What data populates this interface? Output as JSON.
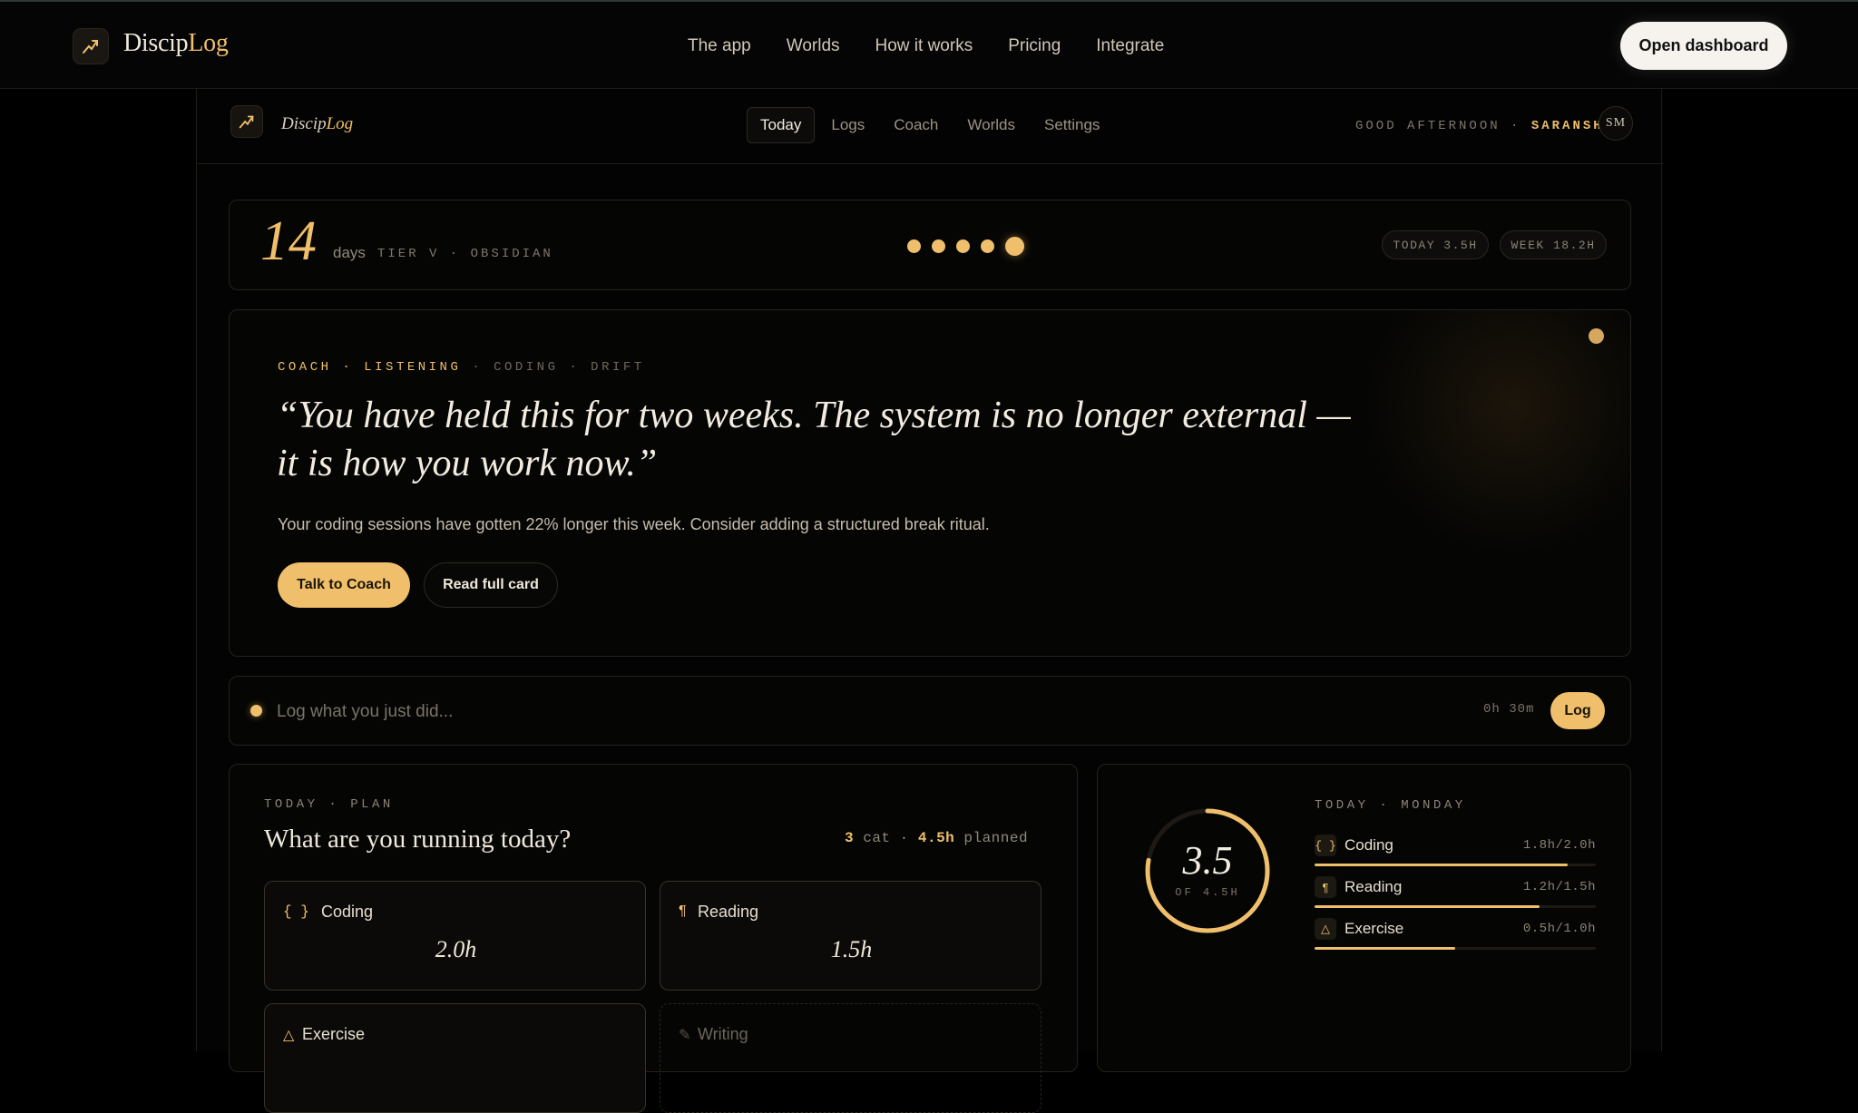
{
  "site": {
    "logo_a": "Discip",
    "logo_b": "Log",
    "links": [
      "The app",
      "Worlds",
      "How it works",
      "Pricing",
      "Integrate"
    ],
    "cta": "Open dashboard"
  },
  "app": {
    "logo_a": "Discip",
    "logo_b": "Log",
    "tabs": [
      "Today",
      "Logs",
      "Coach",
      "Worlds",
      "Settings"
    ],
    "active_tab": "Today",
    "greeting": "GOOD AFTERNOON",
    "greeting_sep": " · ",
    "user_name": "SARANSH",
    "avatar_initials": "SM"
  },
  "streak": {
    "count": "14",
    "unit": "days",
    "tier": "TIER V · OBSIDIAN",
    "today_pill": "TODAY 3.5H",
    "week_pill": "WEEK 18.2H",
    "dots_filled": 5
  },
  "coach": {
    "tag_coach": "COACH",
    "tag_listening": "LISTENING",
    "tag_rest": "· CODING · DRIFT",
    "sep": " · ",
    "quote": "“You have held this for two weeks. The system is no longer external — it is how you work now.”",
    "body": "Your coding sessions have gotten 22% longer this week. Consider adding a structured break ritual.",
    "primary_button": "Talk to Coach",
    "secondary_button": "Read full card"
  },
  "log_bar": {
    "placeholder": "Log what you just did...",
    "duration": "0h 30m",
    "button": "Log"
  },
  "plan": {
    "label": "TODAY · PLAN",
    "title": "What are you running today?",
    "summary_cat_count": "3",
    "summary_cat_word": "cat",
    "summary_sep": "·",
    "summary_hours": "4.5h",
    "summary_planned": "planned",
    "tiles": [
      {
        "icon": "{ }",
        "name": "Coding",
        "hours": "2.0h"
      },
      {
        "icon": "¶",
        "name": "Reading",
        "hours": "1.5h"
      },
      {
        "icon": "△",
        "name": "Exercise",
        "hours": ""
      },
      {
        "icon": "✎",
        "name": "Writing",
        "hours": ""
      }
    ]
  },
  "today": {
    "label": "TODAY · MONDAY",
    "ring_value": "3.5",
    "ring_sub": "OF 4.5H",
    "ring_fraction": 0.778,
    "categories": [
      {
        "icon": "{ }",
        "name": "Coding",
        "value": "1.8h/2.0h",
        "fraction": 0.9
      },
      {
        "icon": "¶",
        "name": "Reading",
        "value": "1.2h/1.5h",
        "fraction": 0.8
      },
      {
        "icon": "△",
        "name": "Exercise",
        "value": "0.5h/1.0h",
        "fraction": 0.5
      }
    ]
  },
  "colors": {
    "accent": "#f0bf6b",
    "background": "#000000",
    "border": "#25221c"
  }
}
